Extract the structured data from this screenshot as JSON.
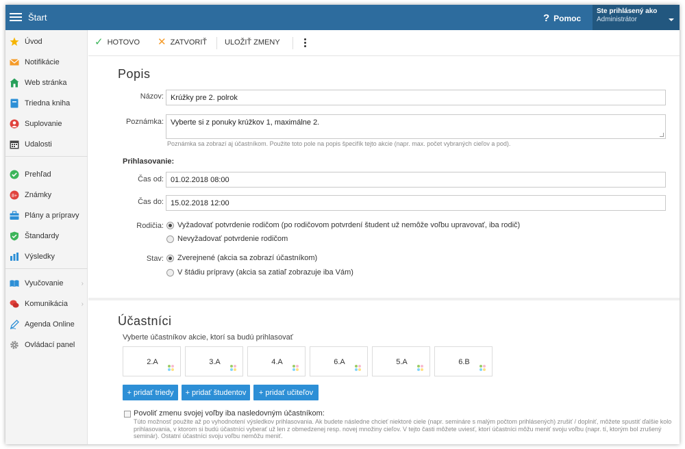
{
  "topbar": {
    "title": "Štart",
    "help": "Pomoc",
    "user_line1": "Ste prihlásený ako",
    "user_line2": "Administrátor"
  },
  "sidebar": {
    "items": [
      {
        "label": "Úvod",
        "icon": "star-icon",
        "color": "#f5b400"
      },
      {
        "label": "Notifikácie",
        "icon": "envelope-icon",
        "color": "#f59b29"
      },
      {
        "label": "Web stránka",
        "icon": "home-icon",
        "color": "#27a05a"
      },
      {
        "label": "Triedna kniha",
        "icon": "book-icon",
        "color": "#2d8fd6"
      },
      {
        "label": "Suplovanie",
        "icon": "person-icon",
        "color": "#e0433d"
      },
      {
        "label": "Udalosti",
        "icon": "calendar-icon",
        "color": "#444444"
      },
      {
        "label": "Prehľad",
        "icon": "check-circle-icon",
        "color": "#3cb55a"
      },
      {
        "label": "Známky",
        "icon": "grades-icon",
        "color": "#e0433d"
      },
      {
        "label": "Plány a prípravy",
        "icon": "briefcase-icon",
        "color": "#2d8fd6"
      },
      {
        "label": "Štandardy",
        "icon": "shield-icon",
        "color": "#3cb55a"
      },
      {
        "label": "Výsledky",
        "icon": "bar-chart-icon",
        "color": "#2d8fd6"
      },
      {
        "label": "Vyučovanie",
        "icon": "open-book-icon",
        "color": "#2d8fd6",
        "arrow": "›"
      },
      {
        "label": "Komunikácia",
        "icon": "chat-icon",
        "color": "#e0433d",
        "arrow": "›"
      },
      {
        "label": "Agenda Online",
        "icon": "pen-icon",
        "color": "#2d8fd6"
      },
      {
        "label": "Ovládací panel",
        "icon": "gear-icon",
        "color": "#888888"
      }
    ]
  },
  "toolbar": {
    "done": "HOTOVO",
    "close": "ZATVORIŤ",
    "save": "ULOŽIŤ ZMENY"
  },
  "popis": {
    "heading": "Popis",
    "name_label": "Názov:",
    "name_value": "Krúžky pre 2. polrok",
    "note_label": "Poznámka:",
    "note_value": "Vyberte si z ponuky krúžkov 1, maximálne 2.",
    "note_hint": "Poznámka sa zobrazí aj účastníkom. Použite toto pole na popis špecifík tejto akcie (napr. max. počet vybraných cieľov a pod)."
  },
  "signup": {
    "label": "Prihlasovanie:",
    "from_label": "Čas od:",
    "from_value": "01.02.2018 08:00",
    "to_label": "Čas do:",
    "to_value": "15.02.2018 12:00",
    "parents_label": "Rodičia:",
    "parents_opt1": "Vyžadovať potvrdenie rodičom (po rodičovom potvrdení študent už nemôže voľbu upravovať, iba rodič)",
    "parents_opt2": "Nevyžadovať potvrdenie rodičom",
    "state_label": "Stav:",
    "state_opt1": "Zverejnené (akcia sa zobrazí účastníkom)",
    "state_opt2": "V štádiu prípravy (akcia sa zatiaľ zobrazuje iba Vám)"
  },
  "participants": {
    "heading": "Účastníci",
    "subtitle": "Vyberte účastníkov akcie, ktorí sa budú prihlasovať",
    "classes": [
      "2.A",
      "3.A",
      "4.A",
      "6.A",
      "5.A",
      "6.B"
    ],
    "add_classes": "+ pridať triedy",
    "add_students": "+ pridať študentov",
    "add_teachers": "+ pridať učiteľov",
    "allow_change_label": "Povoliť zmenu svojej voľby iba nasledovným účastníkom:",
    "allow_change_hint": "Túto možnosť použite až po vyhodnotení výsledkov prihlasovania. Ak budete následne chcieť niektoré ciele (napr. semináre s malým počtom prihlásených) zrušiť / doplniť, môžete spustiť ďalšie kolo prihlasovania, v ktorom si budú účastníci vyberať už len z obmedzenej resp. novej množiny cieľov. V tejto časti môžete uviesť, ktorí účastníci môžu meniť svoju voľbu (napr. tí, ktorým bol zrušený seminár). Ostatní účastníci svoju voľbu nemôžu meniť."
  }
}
